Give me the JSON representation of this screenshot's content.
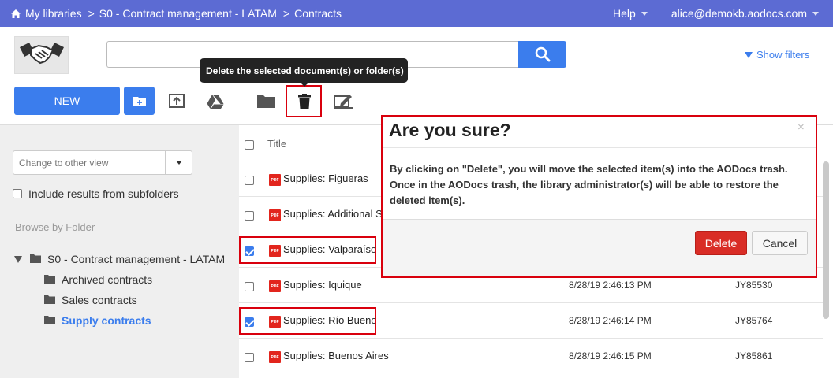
{
  "topbar": {
    "breadcrumbs": [
      "My libraries",
      "S0 - Contract management - LATAM",
      "Contracts"
    ],
    "separator": ">",
    "help_label": "Help",
    "user_email": "alice@demokb.aodocs.com",
    "bg_color": "#5c6bd3"
  },
  "header": {
    "search_placeholder": "",
    "show_filters_label": "Show filters"
  },
  "tooltip": {
    "text": "Delete the selected document(s) or folder(s)"
  },
  "toolbar": {
    "new_label": "NEW",
    "icons": [
      "new-folder-icon",
      "upload-icon",
      "google-drive-icon",
      "move-to-folder-icon",
      "trash-icon",
      "edit-icon"
    ]
  },
  "sidebar": {
    "view_select_placeholder": "Change to other view",
    "include_subfolders_label": "Include results from subfolders",
    "include_subfolders_checked": false,
    "browse_label": "Browse by Folder",
    "root_folder": "S0 - Contract management - LATAM",
    "folders": [
      {
        "label": "Archived contracts",
        "active": false
      },
      {
        "label": "Sales contracts",
        "active": false
      },
      {
        "label": "Supply contracts",
        "active": true
      }
    ]
  },
  "list": {
    "title_header": "Title",
    "rows": [
      {
        "name": "Supplies: Figueras",
        "date": "",
        "ref": "",
        "checked": false
      },
      {
        "name": "Supplies: Additional S",
        "date": "",
        "ref": "",
        "checked": false
      },
      {
        "name": "Supplies: Valparaíso",
        "date": "",
        "ref": "",
        "checked": true
      },
      {
        "name": "Supplies: Iquique",
        "date": "8/28/19 2:46:13 PM",
        "ref": "JY85530",
        "checked": false
      },
      {
        "name": "Supplies: Río Bueno",
        "date": "8/28/19 2:46:14 PM",
        "ref": "JY85764",
        "checked": true
      },
      {
        "name": "Supplies: Buenos Aires",
        "date": "8/28/19 2:46:15 PM",
        "ref": "JY85861",
        "checked": false
      }
    ],
    "pdf_badge": "PDF"
  },
  "modal": {
    "title": "Are you sure?",
    "close_glyph": "×",
    "body": "By clicking on \"Delete\", you will move the selected item(s) into the AODocs trash. Once in the AODocs trash, the library administrator(s) will be able to restore the deleted item(s).",
    "delete_label": "Delete",
    "cancel_label": "Cancel",
    "delete_color": "#d92d26"
  },
  "highlight_color": "#d9000d"
}
